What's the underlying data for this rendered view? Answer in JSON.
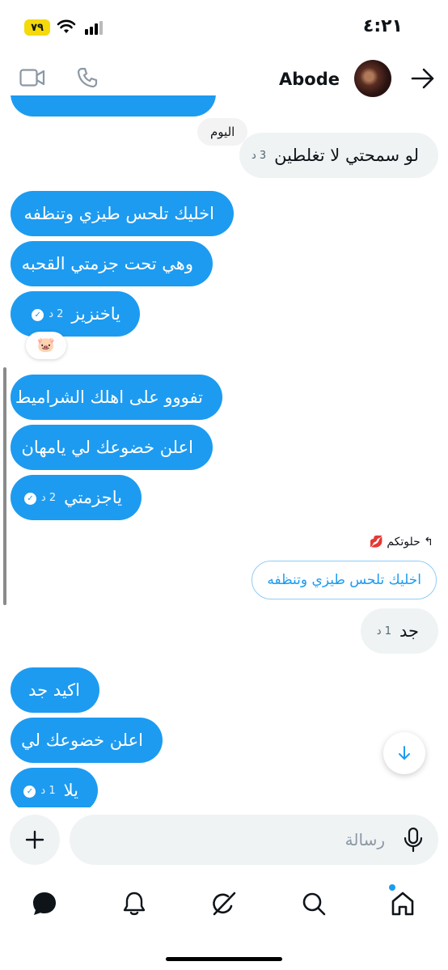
{
  "status_bar": {
    "time": "٤:٢١",
    "battery": "٧٩"
  },
  "header": {
    "contact_name": "Abode"
  },
  "day_separator": "اليوم",
  "messages": [
    {
      "text": "لو سمحتي لا تغلطين",
      "time": "3 د"
    },
    {
      "text": "اخليك تلحس طيزي وتنظفه"
    },
    {
      "text": "وهي تحت جزمتي القحبه"
    },
    {
      "text": "ياخنزيز",
      "time": "2 د"
    },
    {
      "text": "تفووو على اهلك الشراميط"
    },
    {
      "text": "اعلن خضوعك لي يامهان"
    },
    {
      "text": "ياجزمتي",
      "time": "2 د"
    },
    {
      "text": "جد",
      "time": "1 د"
    },
    {
      "text": "اكيد جد"
    },
    {
      "text": "اعلن خضوعك لي"
    },
    {
      "text": "يلا",
      "time": "1 د"
    }
  ],
  "reaction": "🐷",
  "reply": {
    "label": "حلوتكم 💋",
    "quoted_text": "اخليك تلحس طيزي وتنظفه"
  },
  "composer": {
    "placeholder": "رسالة"
  },
  "colors": {
    "accent": "#1d9bf0",
    "received_bubble": "#eff3f4"
  },
  "nav": {
    "icons": [
      "messages-icon",
      "notifications-icon",
      "grok-icon",
      "search-icon",
      "home-icon"
    ]
  }
}
